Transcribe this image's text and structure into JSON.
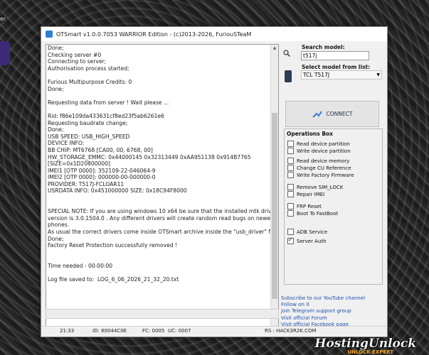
{
  "desktop": {
    "label": "er"
  },
  "window": {
    "title": "OTSmart  v1.0.0.7053 WARRIOR Edition - (c)2013-2026, FuriouSTeaM"
  },
  "log": {
    "lines": [
      "Done;",
      "Checking server #0",
      "Connecting to server;",
      "Authorisation process started;",
      "",
      "Furious Multipurpose Credits: 0",
      "Done;",
      "",
      "Requesting data from server ! Wait please ...",
      "",
      "Rid: f86e109da433631cf8ed23f5ab6261e6",
      "Requesting baudrate change;",
      "Done;",
      "USB SPEED: USB_HIGH_SPEED",
      "DEVICE INFO:",
      "BB CHIP: MT6768 [CA00, 00, 6768, 00]",
      "HW_STORAGE_EMMC: 0x44000145 0x32313449 0xAA951138 0x914B7765",
      "[SIZE=0x1D20800000]",
      "IMEI1 [OTP 0000]: 352109-22-046064-9",
      "IMEI2 [OTP 0000]: 000000-00-000000-0",
      "PROVIDER: T517J-FCLOAR11",
      "USRDATA INFO: 0x451000000 SIZE: 0x18C94F8000",
      "",
      "",
      "SPECIAL NOTE: If you are using windows 10 x64 be sure that the installed mtk driver",
      "version is 3.0.1504.0 . Any different drivers will create random read bugs on newer chipset",
      "phones.",
      "As usual the correct drivers come inside OTSmart archive inside the \"usb_driver\" folder",
      "Done;",
      "Factory Reset Protection successfully removed !",
      "",
      "",
      "Time needed - 00:00:00",
      "",
      "Log file saved to:  LOG_6_06_2026_21_32_20.txt"
    ]
  },
  "search": {
    "label": "Search model:",
    "value": "t517j"
  },
  "select": {
    "label": "Select model from list:",
    "value": "TCL T517J"
  },
  "connect": {
    "label": "CONNECT"
  },
  "ops": {
    "title": "Operations Box",
    "items": [
      {
        "label": "Read device partition",
        "checked": false
      },
      {
        "label": "Write device partition",
        "checked": false
      },
      {
        "label": "Read device memory",
        "checked": false
      },
      {
        "label": "Change CU Reference",
        "checked": false
      },
      {
        "label": "Write Factory Firmware",
        "checked": false
      },
      {
        "label": "Remove SIM_LOCK",
        "checked": false
      },
      {
        "label": "Repair IMEI",
        "checked": false
      },
      {
        "label": "FRP Reset",
        "checked": false
      },
      {
        "label": "Boot To FastBoot",
        "checked": false
      },
      {
        "label": "ADB Service",
        "checked": false
      },
      {
        "label": "Server Auth",
        "checked": true
      }
    ]
  },
  "links": [
    "Subscribe to our YouTube channel",
    "Follow on X",
    "Join Telegram support group",
    "Visit official Forum",
    "Visit official Facebook page"
  ],
  "status": {
    "time": "21:33",
    "id": "ID: 80044C0E",
    "fc": "FC: 0005",
    "uc": "UC: 0007",
    "rs": "RS : HACK3R2K.COM"
  },
  "watermark": {
    "brand": "HostingUnlock",
    "sub": "UNLOCK EXPERT"
  }
}
